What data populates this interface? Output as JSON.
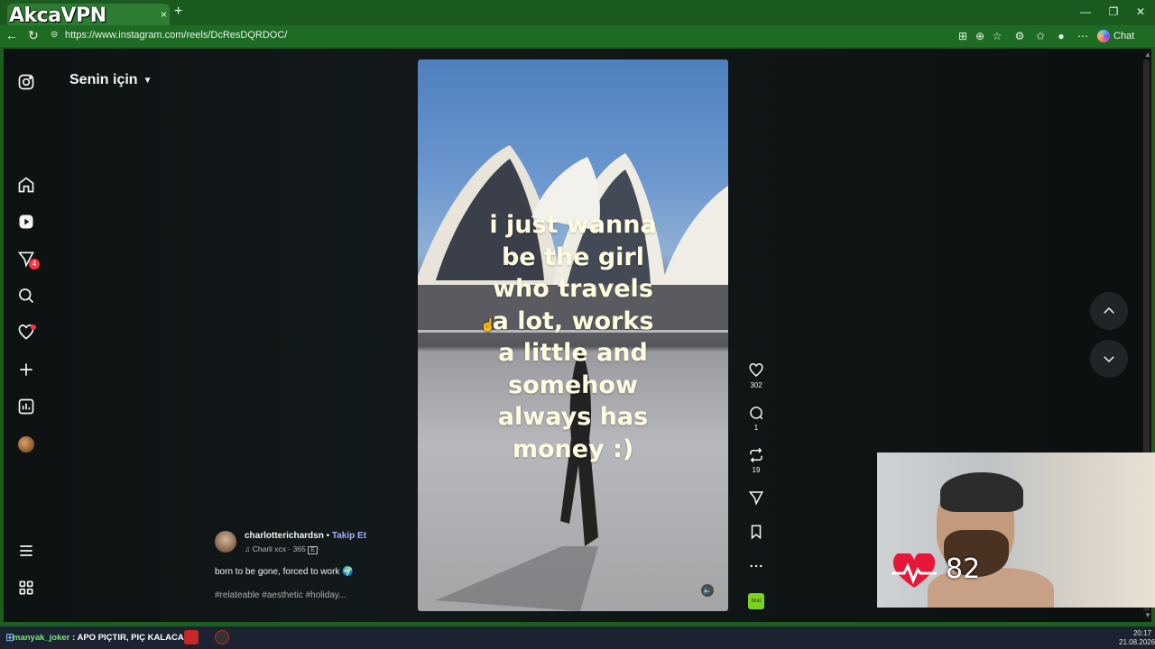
{
  "browser": {
    "tab_logo": "AkcaVPN",
    "tab_close": "×",
    "new_tab": "+",
    "url": "https://www.instagram.com/reels/DcResDQRDOC/",
    "chat_label": "Chat",
    "window_controls": [
      "—",
      "❐",
      "✕"
    ]
  },
  "sidebar": {
    "title": "Senin için",
    "message_badge": "4",
    "icons": [
      "instagram-icon",
      "home-icon",
      "reels-icon",
      "messages-icon",
      "search-icon",
      "notifications-icon",
      "create-icon",
      "dashboard-icon",
      "profile-avatar",
      "menu-icon",
      "more-apps-icon"
    ]
  },
  "reel": {
    "caption_lines": [
      "i just wanna",
      "be the girl",
      "who travels",
      "a lot, works",
      "a little and",
      "somehow",
      "always has",
      "money :)"
    ],
    "author": "charlotterichardsn",
    "separator": " • ",
    "follow_label": "Takip Et",
    "audio": "Charli xcx · 365",
    "audio_badge": "E",
    "description": "born to be gone, forced to work 🌍",
    "hashtags": "#relateable #aesthetic #holiday..."
  },
  "actions": {
    "likes": "302",
    "comments": "1",
    "reposts": "19",
    "music_thumb_label": "brat"
  },
  "overlay": {
    "heart_rate": "82"
  },
  "taskbar": {
    "ticker_user": "manyak_joker",
    "ticker_text": " : APO PIÇTIR, PIÇ KALACAK",
    "time": "20:17",
    "date": "21.08.2026"
  },
  "colors": {
    "browser_frame": "#1b5e20",
    "follow_link": "#a4b0ff",
    "caption_text": "#fffde0",
    "badge": "#ff3040"
  }
}
